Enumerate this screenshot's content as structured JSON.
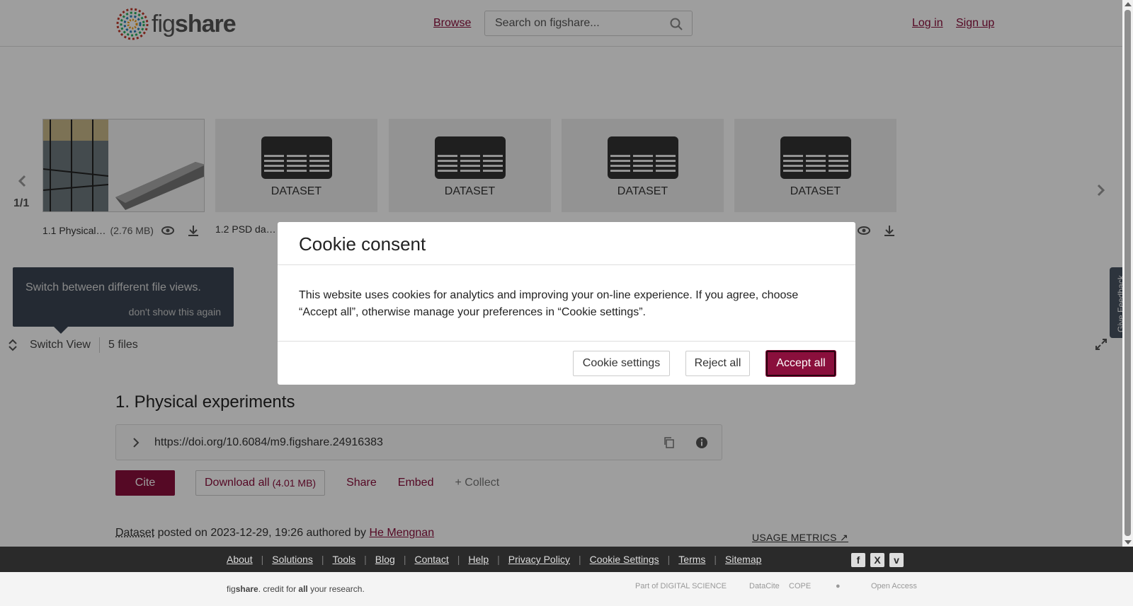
{
  "header": {
    "logo_prefix": "fig",
    "logo_suffix": "share",
    "browse_label": "Browse",
    "search_placeholder": "Search on figshare...",
    "login_label": "Log in",
    "signup_label": "Sign up"
  },
  "viewer": {
    "counter": "1/1",
    "thumbnails": [
      {
        "label": "",
        "caption": "1.1 Physical…",
        "size": "(2.76 MB)"
      },
      {
        "label": "DATASET",
        "caption": "1.2 PSD da…",
        "size": ""
      },
      {
        "label": "DATASET",
        "caption": "",
        "size": ""
      },
      {
        "label": "DATASET",
        "caption": "",
        "size": ""
      },
      {
        "label": "DATASET",
        "caption": "",
        "size": ""
      }
    ],
    "tooltip_text": "Switch between different file views.",
    "tooltip_dismiss": "don't show this again",
    "switch_view_label": "Switch View",
    "files_count": "5 files",
    "feedback_label": "Give Feedback"
  },
  "item": {
    "title": "1. Physical experiments",
    "doi": "https://doi.org/10.6084/m9.figshare.24916383",
    "cite_label": "Cite",
    "download_label": "Download all",
    "download_size": "(4.01 MB)",
    "share_label": "Share",
    "embed_label": "Embed",
    "collect_label": "+ Collect",
    "posted_type": "Dataset",
    "posted_text": " posted on 2023-12-29, 19:26 authored by ",
    "author": "He Mengnan",
    "usage_metrics": "USAGE METRICS"
  },
  "footer": {
    "links": [
      "About",
      "Solutions",
      "Tools",
      "Blog",
      "Contact",
      "Help",
      "Privacy Policy",
      "Cookie Settings",
      "Terms",
      "Sitemap"
    ],
    "credit_prefix": "fig",
    "credit_brand": "share",
    "credit_mid": ". credit for ",
    "credit_all": "all",
    "credit_end": " your research.",
    "partner_digital_science": "Part of DIGITAL SCIENCE",
    "partner_datacite": "DataCite",
    "partner_cope": "COPE",
    "partner_open_access": "Open Access"
  },
  "cookie_modal": {
    "title": "Cookie consent",
    "body": "This website uses cookies for analytics and improving your on-line experience. If you agree, choose “Accept all”, otherwise manage your preferences in “Cookie settings”.",
    "settings_label": "Cookie settings",
    "reject_label": "Reject all",
    "accept_label": "Accept all"
  },
  "colors": {
    "brand": "#8a0f3c",
    "overlay": "rgba(0,0,0,0.38)",
    "footer_dark": "#2a2a2a"
  }
}
